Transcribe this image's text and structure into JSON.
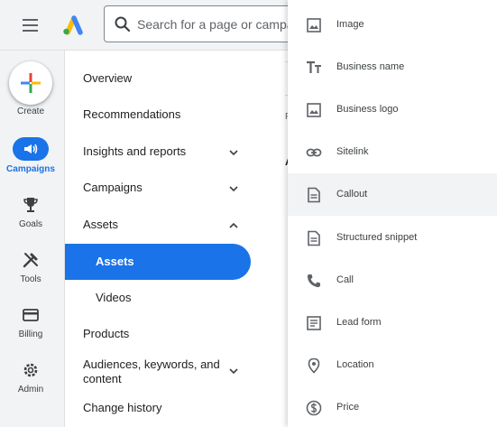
{
  "search": {
    "placeholder": "Search for a page or campaign"
  },
  "create_label": "Create",
  "rail": [
    {
      "label": "Campaigns",
      "icon": "megaphone-icon",
      "active": true
    },
    {
      "label": "Goals",
      "icon": "trophy-icon"
    },
    {
      "label": "Tools",
      "icon": "tools-icon"
    },
    {
      "label": "Billing",
      "icon": "credit-card-icon"
    },
    {
      "label": "Admin",
      "icon": "gear-icon"
    }
  ],
  "nav": [
    {
      "label": "Overview"
    },
    {
      "label": "Recommendations"
    },
    {
      "label": "Insights and reports",
      "chevron": "down"
    },
    {
      "label": "Campaigns",
      "chevron": "down"
    },
    {
      "label": "Assets",
      "chevron": "up"
    },
    {
      "label": "Assets",
      "selected": true
    },
    {
      "label": "Videos"
    },
    {
      "label": "Products"
    },
    {
      "label": "Audiences, keywords, and content",
      "chevron": "down"
    },
    {
      "label": "Change history"
    }
  ],
  "peek": {
    "small": "F",
    "heading": "A"
  },
  "asset_types": [
    {
      "label": "Image",
      "icon": "image-icon"
    },
    {
      "label": "Business name",
      "icon": "text-icon"
    },
    {
      "label": "Business logo",
      "icon": "image-icon"
    },
    {
      "label": "Sitelink",
      "icon": "link-icon"
    },
    {
      "label": "Callout",
      "icon": "document-icon",
      "highlighted": true
    },
    {
      "label": "Structured snippet",
      "icon": "document-icon"
    },
    {
      "label": "Call",
      "icon": "phone-icon"
    },
    {
      "label": "Lead form",
      "icon": "form-icon"
    },
    {
      "label": "Location",
      "icon": "location-pin-icon"
    },
    {
      "label": "Price",
      "icon": "price-icon"
    }
  ],
  "colors": {
    "accent": "#1a73e8",
    "rail_bg": "#f1f3f4",
    "highlight": "#f1f3f4"
  }
}
